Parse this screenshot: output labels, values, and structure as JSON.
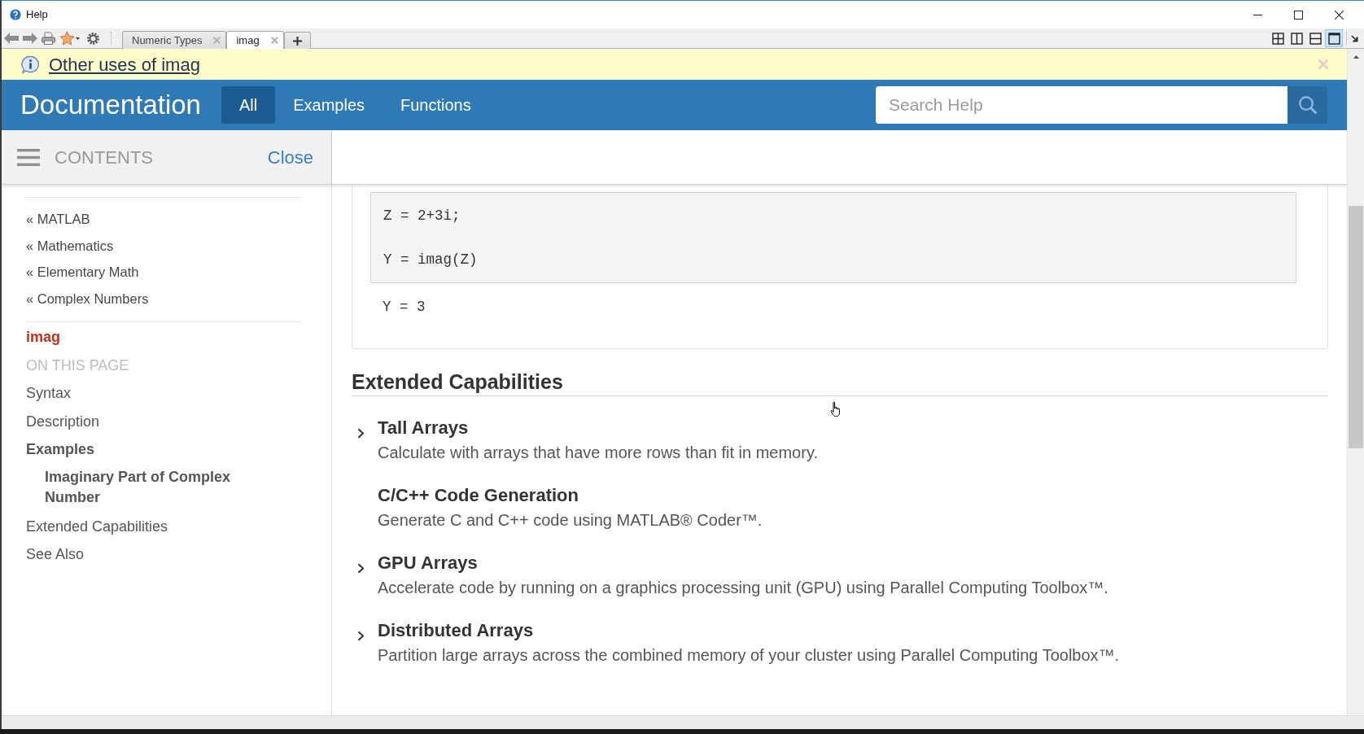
{
  "window": {
    "title": "Help"
  },
  "toolbar": {
    "tabs": [
      {
        "label": "Numeric Types",
        "selected": false
      },
      {
        "label": "imag",
        "selected": true
      }
    ],
    "layouts": [
      {
        "kind": "grid",
        "selected": false
      },
      {
        "kind": "columns",
        "selected": false
      },
      {
        "kind": "rows",
        "selected": false
      },
      {
        "kind": "single",
        "selected": true
      }
    ]
  },
  "info_bar": {
    "link": "Other uses of imag"
  },
  "header": {
    "brand": "Documentation",
    "tabs": [
      {
        "label": "All",
        "selected": true
      },
      {
        "label": "Examples",
        "selected": false
      },
      {
        "label": "Functions",
        "selected": false
      }
    ],
    "search": {
      "placeholder": "Search Help"
    }
  },
  "sidebar": {
    "title": "CONTENTS",
    "close": "Close",
    "breadcrumbs": [
      "« MATLAB",
      "« Mathematics",
      "« Elementary Math",
      "« Complex Numbers"
    ],
    "current_page": "imag",
    "section_label": "ON THIS PAGE",
    "items": [
      {
        "label": "Syntax",
        "selected": false
      },
      {
        "label": "Description",
        "selected": false
      },
      {
        "label": "Examples",
        "selected": true,
        "children": [
          {
            "label": "Imaginary Part of Complex Number",
            "selected": true
          }
        ]
      },
      {
        "label": "Extended Capabilities",
        "selected": false
      },
      {
        "label": "See Also",
        "selected": false
      }
    ]
  },
  "content": {
    "code_lines": [
      "Z = 2+3i;",
      "Y = imag(Z)"
    ],
    "output": "Y = 3",
    "section_heading": "Extended Capabilities",
    "capabilities": [
      {
        "title": "Tall Arrays",
        "description": "Calculate with arrays that have more rows than fit in memory.",
        "expandable": true
      },
      {
        "title": "C/C++ Code Generation",
        "description": "Generate C and C++ code using MATLAB® Coder™.",
        "expandable": false
      },
      {
        "title": "GPU Arrays",
        "description": "Accelerate code by running on a graphics processing unit (GPU) using Parallel Computing Toolbox™.",
        "expandable": true
      },
      {
        "title": "Distributed Arrays",
        "description": "Partition large arrays across the combined memory of your cluster using Parallel Computing Toolbox™.",
        "expandable": true
      }
    ]
  }
}
